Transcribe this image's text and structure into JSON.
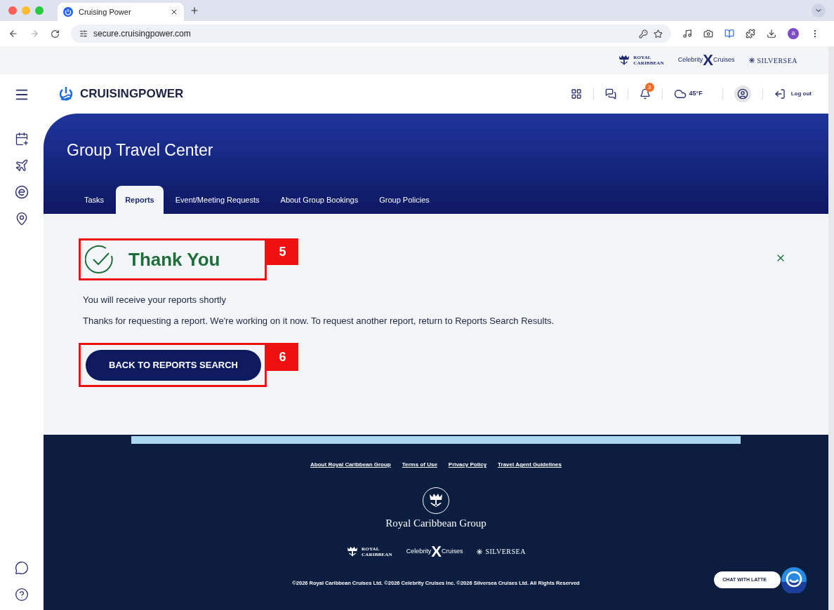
{
  "browser": {
    "tab_title": "Cruising Power",
    "url": "secure.cruisingpower.com",
    "profile_letter": "a"
  },
  "brand_strip": {
    "logos": [
      {
        "kind": "royal",
        "lines": [
          "ROYAL",
          "CARIBBEAN"
        ]
      },
      {
        "kind": "celebrity",
        "before": "Celebrity",
        "mark": "X",
        "after": "Cruises"
      },
      {
        "kind": "silversea",
        "text": "SILVERSEA"
      }
    ]
  },
  "header": {
    "logo_text": "CRUISINGPOWER",
    "notification_count": "3",
    "weather": "45°F",
    "logout": "Log out"
  },
  "hero": {
    "title": "Group Travel Center",
    "tabs": [
      {
        "label": "Tasks",
        "selected": false
      },
      {
        "label": "Reports",
        "selected": true
      },
      {
        "label": "Event/Meeting Requests",
        "selected": false
      },
      {
        "label": "About Group Bookings",
        "selected": false
      },
      {
        "label": "Group Policies",
        "selected": false
      }
    ]
  },
  "message": {
    "title": "Thank You",
    "title_callout": "5",
    "lines": [
      "You will receive your reports shortly",
      "Thanks for requesting a report. We're working on it now. To request another report, return to Reports Search Results."
    ],
    "button": "BACK TO REPORTS SEARCH",
    "button_callout": "6"
  },
  "footer": {
    "links": [
      "About Royal Caribbean Group",
      "Terms of Use",
      "Privacy Policy",
      "Travel Agent Guidelines"
    ],
    "group_name": "Royal Caribbean Group",
    "logos": [
      {
        "kind": "royal",
        "lines": [
          "ROYAL",
          "CARIBBEAN"
        ]
      },
      {
        "kind": "celebrity",
        "before": "Celebrity",
        "mark": "X",
        "after": "Cruises"
      },
      {
        "kind": "silversea",
        "text": "SILVERSEA"
      }
    ],
    "copyright": "©2026 Royal Caribbean Cruises Ltd. ©2026 Celebrity Cruises Inc. ©2026 Silversea Cruises Ltd. All Rights Reserved",
    "chat": "CHAT WITH LATTE"
  }
}
